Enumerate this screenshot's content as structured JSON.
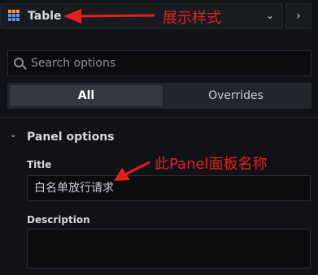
{
  "visualization": {
    "name": "Table",
    "annotation": "展示样式"
  },
  "search": {
    "placeholder": "Search options"
  },
  "tabs": [
    {
      "label": "All",
      "active": true
    },
    {
      "label": "Overrides",
      "active": false
    }
  ],
  "panel_options": {
    "section_title": "Panel options",
    "title_label": "Title",
    "title_value": "白名单放行请求",
    "title_annotation": "此Panel面板名称",
    "description_label": "Description",
    "description_value": ""
  },
  "colors": {
    "background": "#111217",
    "annotation": "#e5201c",
    "table_icon_primary": "#5794f2",
    "table_icon_header": "#ff9830"
  }
}
